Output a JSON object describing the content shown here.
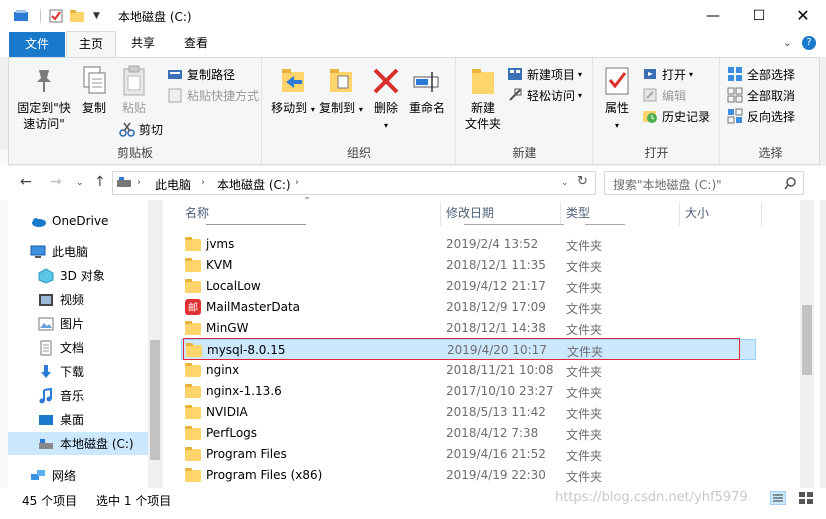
{
  "window": {
    "title": "本地磁盘 (C:)"
  },
  "tabs": {
    "file": "文件",
    "home": "主页",
    "share": "共享",
    "view": "查看"
  },
  "ribbon": {
    "clipboard": {
      "label": "剪贴板",
      "pin": "固定到\"快速访问\"",
      "copy": "复制",
      "paste": "粘贴",
      "copy_path": "复制路径",
      "paste_shortcut": "粘贴快捷方式",
      "cut": "剪切"
    },
    "organize": {
      "label": "组织",
      "move_to": "移动到",
      "copy_to": "复制到",
      "delete": "删除",
      "rename": "重命名"
    },
    "new": {
      "label": "新建",
      "new_folder": "新建\n文件夹",
      "new_item": "新建项目",
      "easy_access": "轻松访问"
    },
    "open": {
      "label": "打开",
      "properties": "属性",
      "open": "打开",
      "edit": "编辑",
      "history": "历史记录"
    },
    "select": {
      "label": "选择",
      "select_all": "全部选择",
      "select_none": "全部取消",
      "invert": "反向选择"
    }
  },
  "address": {
    "segments": [
      "此电脑",
      "本地磁盘 (C:)"
    ],
    "search_placeholder": "搜索\"本地磁盘 (C:)\""
  },
  "nav_pane": {
    "items": [
      {
        "label": "OneDrive",
        "icon": "cloud-icon"
      },
      {
        "label": "此电脑",
        "icon": "computer-icon"
      },
      {
        "label": "3D 对象",
        "icon": "cube-icon"
      },
      {
        "label": "视频",
        "icon": "video-icon"
      },
      {
        "label": "图片",
        "icon": "picture-icon"
      },
      {
        "label": "文档",
        "icon": "document-icon"
      },
      {
        "label": "下载",
        "icon": "download-icon"
      },
      {
        "label": "音乐",
        "icon": "music-icon"
      },
      {
        "label": "桌面",
        "icon": "desktop-icon"
      },
      {
        "label": "本地磁盘 (C:)",
        "icon": "drive-icon"
      },
      {
        "label": "网络",
        "icon": "network-icon"
      }
    ]
  },
  "file_list": {
    "columns": {
      "name": "名称",
      "date": "修改日期",
      "type": "类型",
      "size": "大小"
    },
    "rows": [
      {
        "name": "jvms",
        "date": "2019/2/4 13:52",
        "type": "文件夹",
        "icon": "folder-icon"
      },
      {
        "name": "KVM",
        "date": "2018/12/1 11:35",
        "type": "文件夹",
        "icon": "folder-icon"
      },
      {
        "name": "LocalLow",
        "date": "2019/4/12 21:17",
        "type": "文件夹",
        "icon": "folder-icon"
      },
      {
        "name": "MailMasterData",
        "date": "2018/12/9 17:09",
        "type": "文件夹",
        "icon": "mailmaster-icon"
      },
      {
        "name": "MinGW",
        "date": "2018/12/1 14:38",
        "type": "文件夹",
        "icon": "folder-icon"
      },
      {
        "name": "mysql-8.0.15",
        "date": "2019/4/20 10:17",
        "type": "文件夹",
        "icon": "folder-icon",
        "selected": true
      },
      {
        "name": "nginx",
        "date": "2018/11/21 10:08",
        "type": "文件夹",
        "icon": "folder-icon"
      },
      {
        "name": "nginx-1.13.6",
        "date": "2017/10/10 23:27",
        "type": "文件夹",
        "icon": "folder-icon"
      },
      {
        "name": "NVIDIA",
        "date": "2018/5/13 11:42",
        "type": "文件夹",
        "icon": "folder-icon"
      },
      {
        "name": "PerfLogs",
        "date": "2018/4/12 7:38",
        "type": "文件夹",
        "icon": "folder-icon"
      },
      {
        "name": "Program Files",
        "date": "2019/4/16 21:52",
        "type": "文件夹",
        "icon": "folder-icon"
      },
      {
        "name": "Program Files (x86)",
        "date": "2019/4/19 22:30",
        "type": "文件夹",
        "icon": "folder-icon"
      }
    ]
  },
  "status": {
    "count": "45 个项目",
    "selected": "选中 1 个项目"
  },
  "watermark": "https://blog.csdn.net/yhf5979",
  "colors": {
    "accent": "#1979ca",
    "selection": "#cce8ff",
    "highlight_box": "#e8203a",
    "folder": "#ffd46b"
  }
}
